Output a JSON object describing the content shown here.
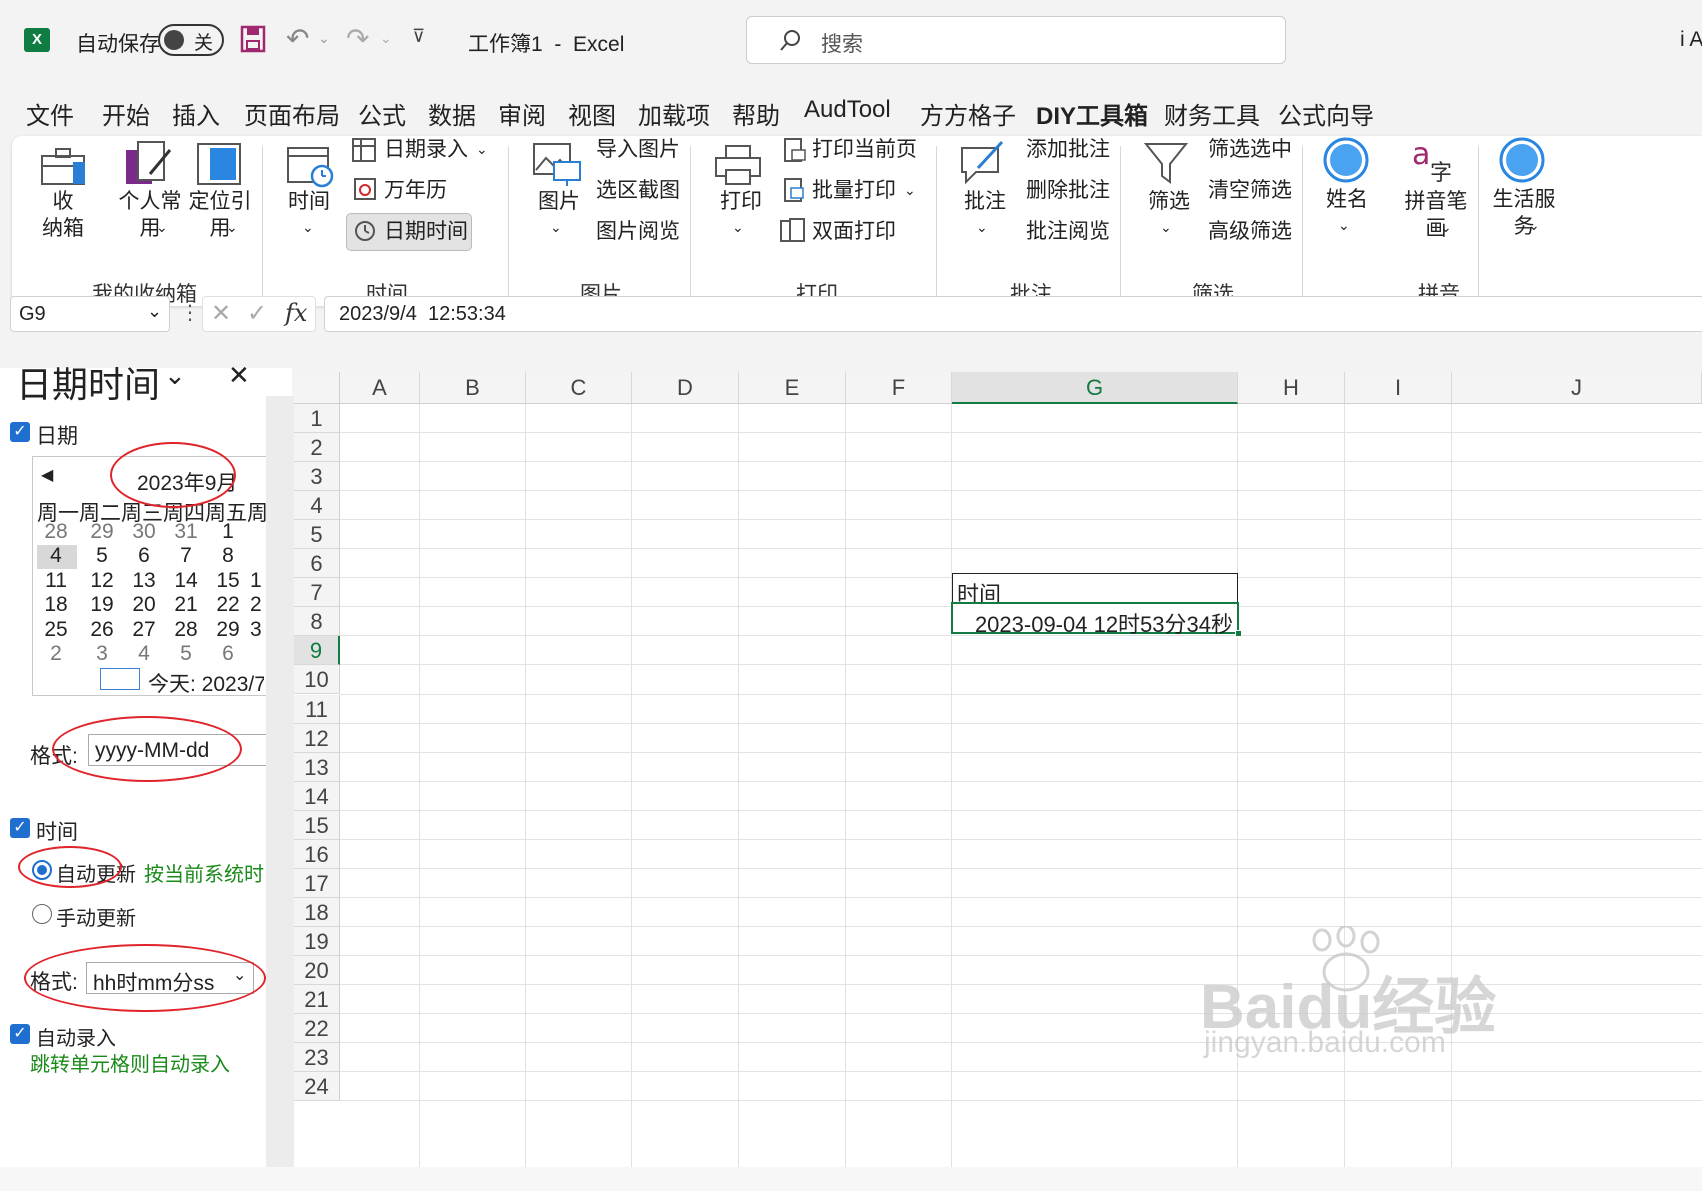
{
  "titlebar": {
    "autosave_label": "自动保存",
    "autosave_toggle": "关",
    "doc_title": "工作簿1  -  Excel",
    "search_placeholder": "搜索",
    "user_partial": "i A"
  },
  "menu_tabs": [
    "文件",
    "开始",
    "插入",
    "页面布局",
    "公式",
    "数据",
    "审阅",
    "视图",
    "加载项",
    "帮助",
    "AudTool",
    "方方格子",
    "DIY工具箱",
    "财务工具",
    "公式向导"
  ],
  "active_tab": "DIY工具箱",
  "ribbon": {
    "g1": {
      "btn1": "收\n纳箱",
      "btn2": "个人常\n用",
      "btn3": "定位引\n用",
      "label": "我的收纳箱"
    },
    "g2": {
      "btn_time": "时间",
      "item1": "日期录入",
      "item2": "万年历",
      "item3": "日期时间",
      "label": "时间"
    },
    "g3": {
      "btn": "图片",
      "item1": "导入图片",
      "item2": "选区截图",
      "item3": "图片阅览",
      "label": "图片"
    },
    "g4": {
      "btn": "打印",
      "item1": "打印当前页",
      "item2": "批量打印",
      "item3": "双面打印",
      "label": "打印"
    },
    "g5": {
      "btn": "批注",
      "item1": "添加批注",
      "item2": "删除批注",
      "item3": "批注阅览",
      "label": "批注"
    },
    "g6": {
      "btn": "筛选",
      "item1": "筛选选中",
      "item2": "清空筛选",
      "item3": "高级筛选",
      "label": "筛选"
    },
    "g7": {
      "btn1": "姓名",
      "btn2": "拼音笔\n画",
      "label": "拼音",
      "btn3": "生活服\n务"
    }
  },
  "formula_bar": {
    "name_box": "G9",
    "fx": "fx",
    "value": "2023/9/4  12:53:34"
  },
  "pane": {
    "title": "日期时间",
    "date_checkbox": "日期",
    "month": "2023年9月",
    "weekdays": [
      "周一",
      "周二",
      "周三",
      "周四",
      "周五",
      "周"
    ],
    "weeks": [
      [
        "28",
        "29",
        "30",
        "31",
        "1",
        ""
      ],
      [
        "4",
        "5",
        "6",
        "7",
        "8",
        ""
      ],
      [
        "11",
        "12",
        "13",
        "14",
        "15",
        "1"
      ],
      [
        "18",
        "19",
        "20",
        "21",
        "22",
        "2"
      ],
      [
        "25",
        "26",
        "27",
        "28",
        "29",
        "3"
      ],
      [
        "2",
        "3",
        "4",
        "5",
        "6",
        ""
      ]
    ],
    "today": "今天: 2023/7/",
    "date_format_label": "格式:",
    "date_format": "yyyy-MM-dd",
    "time_checkbox": "时间",
    "radio_auto": "自动更新",
    "radio_auto_note": "按当前系统时间",
    "radio_manual": "手动更新",
    "time_format_label": "格式:",
    "time_format": "hh时mm分ss",
    "auto_entry": "自动录入",
    "auto_entry_note": "跳转单元格则自动录入"
  },
  "grid": {
    "columns": [
      "A",
      "B",
      "C",
      "D",
      "E",
      "F",
      "G",
      "H",
      "I",
      "J"
    ],
    "rows": [
      "1",
      "2",
      "3",
      "4",
      "5",
      "6",
      "7",
      "8",
      "9",
      "10",
      "11",
      "12",
      "13",
      "14",
      "15",
      "16",
      "17",
      "18",
      "19",
      "20",
      "21",
      "22",
      "23",
      "24"
    ],
    "g8": "时间",
    "g9": "2023-09-04 12时53分34秒"
  },
  "watermark": {
    "logo": "Baidu经验",
    "url": "jingyan.baidu.com"
  }
}
